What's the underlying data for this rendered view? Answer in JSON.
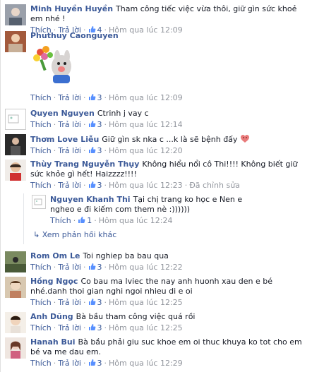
{
  "actions": {
    "like": "Thích",
    "reply": "Trả lời",
    "edited": "Đã chỉnh sửa",
    "more_replies": "Xem phản hồi khác"
  },
  "comments": [
    {
      "name": "Minh Huyền Huyền",
      "text": "Tham công tiếc việc vừa thôi, giữ gìn sức khoẻ em nhé !",
      "likes": "4",
      "time": "Hôm qua lúc 12:09"
    },
    {
      "name": "Phuthuy Caonguyen",
      "text": "",
      "likes": "3",
      "time": "Hôm qua lúc 12:09"
    },
    {
      "name": "Quyen Nguyen",
      "text": "Ctrinh j vay c",
      "likes": "3",
      "time": "Hôm qua lúc 12:14"
    },
    {
      "name": "Thơm Love Liễu",
      "text": "Giữ gìn sk nka c ...k là sẽ bệnh đấy",
      "likes": "3",
      "time": "Hôm qua lúc 12:20"
    },
    {
      "name": "Thùy Trang Nguyễn Thụy",
      "text": "Không hiểu nổi cô Thi!!!! Không biết giữ sức khỏe gì hết! Haizzzz!!!!",
      "likes": "3",
      "time": "Hôm qua lúc 12:23"
    },
    {
      "name": "Nguyen Khanh Thi",
      "text": "Tại chị trang ko học e Nen e ngheo e đi kiếm com them nè :))))))",
      "likes": "1",
      "time": "Hôm qua lúc 12:24"
    },
    {
      "name": "Rom Om Le",
      "text": "Toi nghiep ba bau qua",
      "likes": "3",
      "time": "Hôm qua lúc 12:22"
    },
    {
      "name": "Hồng Ngọc",
      "text": "Co bau ma lviec the nay anh huonh xau den e bé nhé.danh thoi gian nghi ngoi nhieu di e oi",
      "likes": "3",
      "time": "Hôm qua lúc 12:25"
    },
    {
      "name": "Anh Dũng",
      "text": "Bà bầu tham công việc quá rồi",
      "likes": "3",
      "time": "Hôm qua lúc 12:25"
    },
    {
      "name": "Hanah Bui",
      "text": "Bà bầu phải giu suc khoe em oi thuc khuya ko tot cho em bé va me dau em.",
      "likes": "3",
      "time": "Hôm qua lúc 12:29"
    }
  ],
  "colors": {
    "link": "#3b5998",
    "meta": "#90949c"
  },
  "icons": {
    "like": "thumbs-up-icon",
    "reply_arrow": "reply-arrow-icon",
    "emoji": "frowning-emoji-icon"
  }
}
